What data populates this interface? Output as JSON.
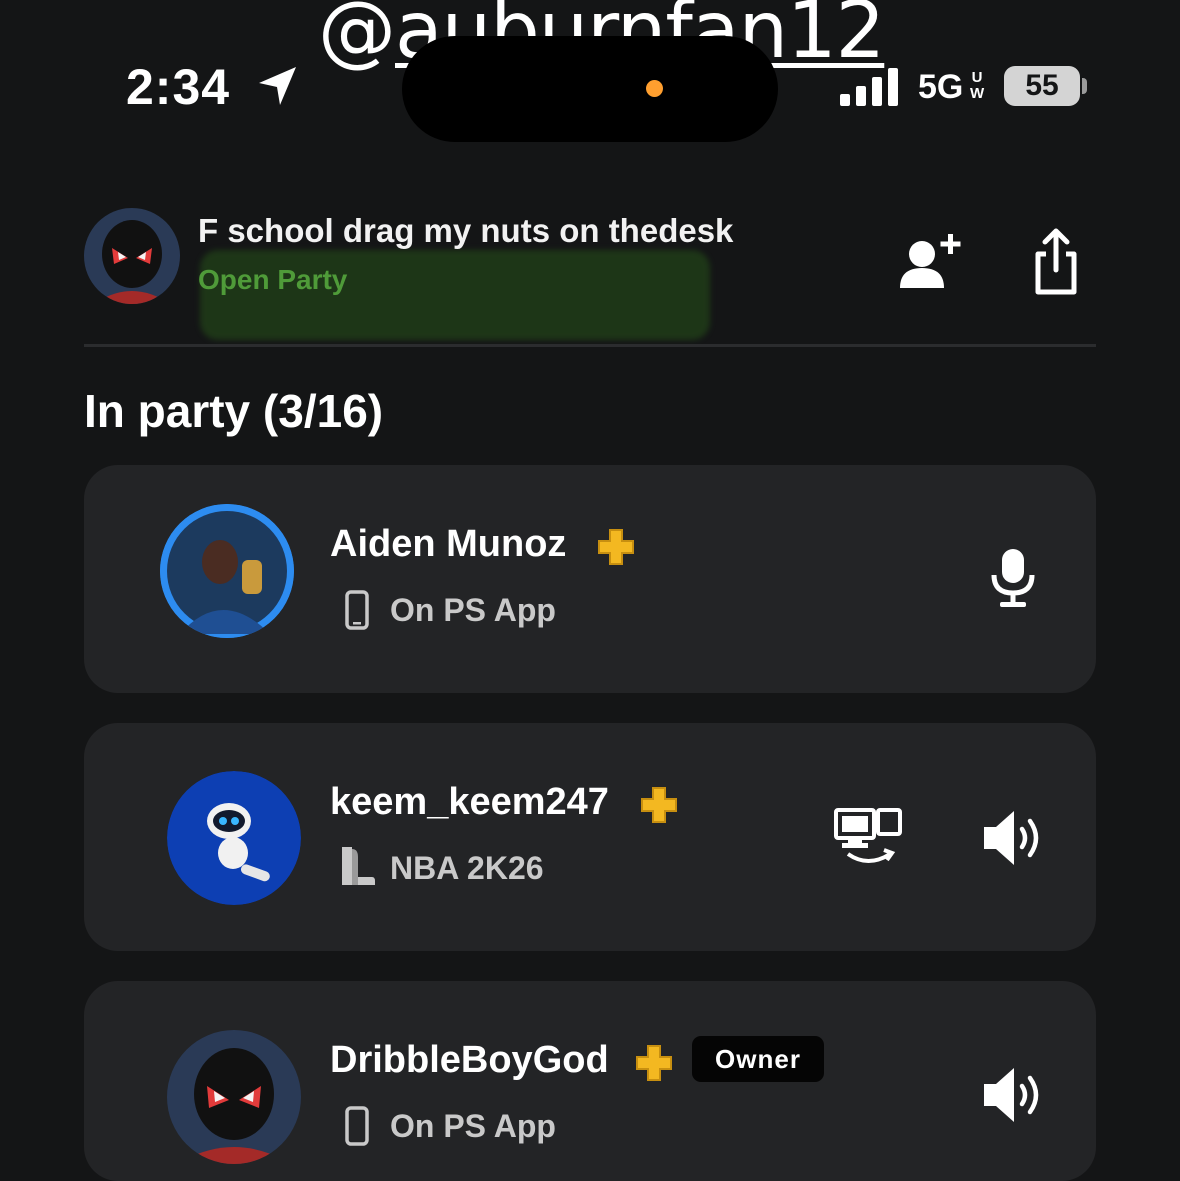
{
  "overlay": {
    "at": "@",
    "handle": "auburnfan12"
  },
  "status_bar": {
    "time": "2:34",
    "network": "5G",
    "network_badge_top": "U",
    "network_badge_bottom": "W",
    "battery": "55"
  },
  "party": {
    "name": "F school drag my nuts on thedesk",
    "status": "Open Party",
    "status_color": "#4f9b39"
  },
  "members_section": {
    "title": "In party (3/16)"
  },
  "members": [
    {
      "name": "Aiden Munoz",
      "device_icon": "phone-icon",
      "activity": "On PS App",
      "right_icon": "microphone-icon",
      "ring_color": "#2d8cf0"
    },
    {
      "name": "keem_keem247",
      "device_icon": "ps5-console-icon",
      "activity": "NBA 2K26",
      "right_icon": "speaker-icon",
      "extra_icon": "remote-play-icon"
    },
    {
      "name": "DribbleBoyGod",
      "badge": "Owner",
      "device_icon": "phone-icon",
      "activity": "On PS App",
      "right_icon": "speaker-icon"
    }
  ],
  "colors": {
    "background": "#141516",
    "card": "#232426",
    "ps_plus": "#f3b821"
  }
}
